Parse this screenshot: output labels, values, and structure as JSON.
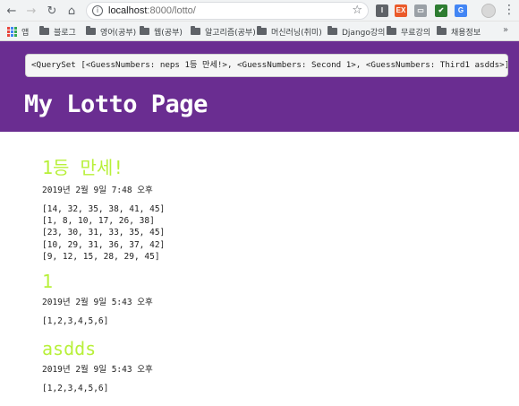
{
  "browser": {
    "url_host": "localhost",
    "url_path": ":8000/lotto/",
    "back_glyph": "←",
    "forward_glyph": "→",
    "reload_glyph": "↻",
    "home_glyph": "⌂",
    "info_glyph": "i",
    "star_glyph": "☆",
    "menu_glyph": "⋮",
    "extensions": [
      {
        "name": "ext-1-icon",
        "label": "I",
        "color": "#5f6368"
      },
      {
        "name": "ext-ex-icon",
        "label": "EX",
        "color": "#ea5a2a"
      },
      {
        "name": "ext-3-icon",
        "label": "▭",
        "color": "#9aa0a6"
      },
      {
        "name": "ext-4-icon",
        "label": "✔",
        "color": "#2e7d32"
      },
      {
        "name": "ext-translate-icon",
        "label": "G",
        "color": "#4285f4"
      }
    ]
  },
  "bookmarks": {
    "apps_label": "앱",
    "items": [
      {
        "label": "블로그"
      },
      {
        "label": "영어(공부)"
      },
      {
        "label": "웹(공부)"
      },
      {
        "label": "알고리즘(공부)"
      },
      {
        "label": "머신러닝(취미)"
      },
      {
        "label": "Django강의"
      },
      {
        "label": "무료강의"
      },
      {
        "label": "채용정보"
      }
    ],
    "more_glyph": "»"
  },
  "header": {
    "queryset_text": "<QuerySet [<GuessNumbers: neps 1등 만세!>, <GuessNumbers: Second 1>, <GuessNumbers: Third1 asdds>]>",
    "title": "My Lotto Page"
  },
  "posts": [
    {
      "title": "1등 만세!",
      "date": "2019년 2월 9일 7:48 오후",
      "numbers": [
        "[14, 32, 35, 38, 41, 45]",
        "[1, 8, 10, 17, 26, 38]",
        "[23, 30, 31, 33, 35, 45]",
        "[10, 29, 31, 36, 37, 42]",
        "[9, 12, 15, 28, 29, 45]"
      ]
    },
    {
      "title": "1",
      "date": "2019년 2월 9일 5:43 오후",
      "numbers": [
        "[1,2,3,4,5,6]"
      ]
    },
    {
      "title": "asdds",
      "date": "2019년 2월 9일 5:43 오후",
      "numbers": [
        "[1,2,3,4,5,6]"
      ]
    }
  ],
  "colors": {
    "header_bg": "#6a2d91",
    "post_title": "#b8f03a"
  }
}
